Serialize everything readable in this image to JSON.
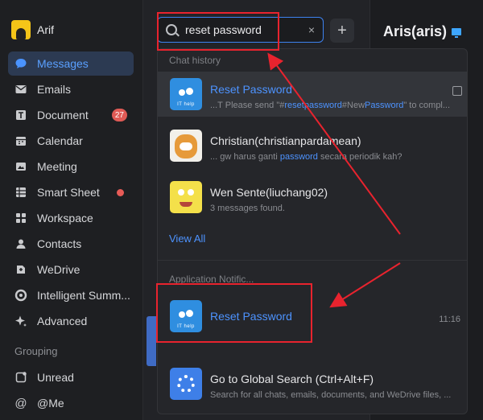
{
  "profile": {
    "name": "Arif"
  },
  "sidebar": {
    "items": [
      {
        "label": "Messages",
        "icon": "chat-bubble-icon",
        "active": true
      },
      {
        "label": "Emails",
        "icon": "envelope-icon"
      },
      {
        "label": "Document",
        "icon": "document-icon",
        "badge": "27"
      },
      {
        "label": "Calendar",
        "icon": "calendar-icon"
      },
      {
        "label": "Meeting",
        "icon": "meeting-icon"
      },
      {
        "label": "Smart Sheet",
        "icon": "sheet-icon",
        "dot": true
      },
      {
        "label": "Workspace",
        "icon": "grid-icon"
      },
      {
        "label": "Contacts",
        "icon": "contacts-icon"
      },
      {
        "label": "WeDrive",
        "icon": "drive-icon"
      },
      {
        "label": "Intelligent Summ...",
        "icon": "summary-icon"
      },
      {
        "label": "Advanced",
        "icon": "sparkle-icon"
      }
    ],
    "grouping_label": "Grouping",
    "groups": [
      {
        "label": "Unread",
        "icon": "unread-icon"
      },
      {
        "label": "@Me",
        "icon": "at-icon"
      }
    ]
  },
  "search": {
    "value": "reset password",
    "clear_icon": "×",
    "plus_label": "+"
  },
  "right": {
    "title": "Aris(aris)"
  },
  "dropdown": {
    "chat_history_label": "Chat history",
    "chat_results": [
      {
        "title": "Reset Password",
        "title_blue": true,
        "sub_parts": [
          "...T Please send \"#",
          "resetpassword",
          "#New",
          "Password",
          "\" to compl..."
        ]
      },
      {
        "title": "Christian(christianpardamean)",
        "sub_parts": [
          "... gw harus ganti ",
          "password",
          " secara periodik kah?"
        ]
      },
      {
        "title": "Wen Sente(liuchang02)",
        "sub_parts": [
          "3 messages found."
        ]
      }
    ],
    "view_all": "View All",
    "app_notif_label": "Application Notific...",
    "app_result": {
      "title": "Reset Password",
      "time": "11:16"
    },
    "ithelp_caption": "IT help",
    "global": {
      "title": "Go to Global Search (Ctrl+Alt+F)",
      "sub": "Search for all chats, emails, documents, and WeDrive files, ..."
    }
  },
  "colors": {
    "accent": "#4d93ff",
    "annotation": "#e8232e",
    "badge": "#e05a55"
  }
}
